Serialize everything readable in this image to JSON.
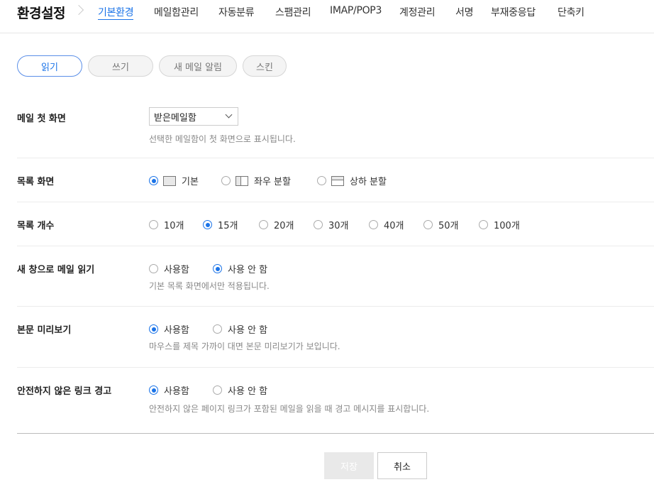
{
  "header": {
    "title": "환경설정",
    "tabs": [
      "기본환경",
      "메일함관리",
      "자동분류",
      "스팸관리",
      "IMAP/POP3",
      "계정관리",
      "서명",
      "부재중응답",
      "단축키"
    ],
    "active_tab": "기본환경"
  },
  "subtabs": [
    "읽기",
    "쓰기",
    "새 메일 알림",
    "스킨"
  ],
  "settings": {
    "first_screen": {
      "label": "메일 첫 화면",
      "select_value": "받은메일함",
      "help": "선택한 메일함이 첫 화면으로 표시됩니다."
    },
    "list_view": {
      "label": "목록 화면",
      "options": [
        "기본",
        "좌우 분할",
        "상하 분할"
      ],
      "selected": "기본"
    },
    "list_count": {
      "label": "목록 개수",
      "options": [
        "10개",
        "15개",
        "20개",
        "30개",
        "40개",
        "50개",
        "100개"
      ],
      "selected": "15개"
    },
    "new_window": {
      "label": "새 창으로 메일 읽기",
      "options": [
        "사용함",
        "사용 안 함"
      ],
      "selected": "사용 안 함",
      "help": "기본 목록 화면에서만 적용됩니다."
    },
    "preview": {
      "label": "본문 미리보기",
      "options": [
        "사용함",
        "사용 안 함"
      ],
      "selected": "사용함",
      "help": "마우스를 제목 가까이 대면 본문 미리보기가 보입니다."
    },
    "unsafe_link": {
      "label": "안전하지 않은 링크 경고",
      "options": [
        "사용함",
        "사용 안 함"
      ],
      "selected": "사용함",
      "help": "안전하지 않은 페이지 링크가 포함된 메일을 읽을 때 경고 메시지를 표시합니다."
    }
  },
  "buttons": {
    "save": "저장",
    "cancel": "취소"
  },
  "colors": {
    "accent": "#1a73e8",
    "save_disabled_bg": "#e9e9e9"
  }
}
